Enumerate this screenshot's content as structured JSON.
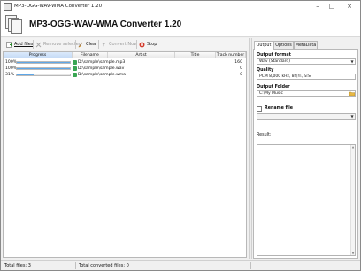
{
  "window": {
    "title": "MP3-OGG-WAV-WMA Converter 1.20",
    "controls": {
      "minimize": "–",
      "maximize": "□",
      "close": "×"
    }
  },
  "header": {
    "app_title": "MP3-OGG-WAV-WMA Converter 1.20"
  },
  "toolbar": {
    "add_files": "Add files",
    "remove_selected": "Remove selected",
    "clear": "Clear",
    "convert_now": "Convert Now",
    "stop": "Stop"
  },
  "file_list": {
    "columns": [
      "Progress",
      "Filename",
      "Artist",
      "Title",
      "Track number"
    ],
    "rows": [
      {
        "progress_label": "100%",
        "progress": 1.0,
        "filename": "D:\\sample\\sample.mp3",
        "artist": "",
        "title": "",
        "track": "160"
      },
      {
        "progress_label": "100%",
        "progress": 1.0,
        "filename": "D:\\sample\\sample.wav",
        "artist": "",
        "title": "",
        "track": "0"
      },
      {
        "progress_label": "31%",
        "progress": 0.31,
        "filename": "D:\\sample\\sample.wma",
        "artist": "",
        "title": "",
        "track": "0"
      }
    ]
  },
  "panel": {
    "tabs": [
      "Output",
      "Options",
      "MetaData"
    ],
    "active_tab": "Output",
    "output_format_label": "Output format",
    "output_format_value": "Wav (Standard)",
    "quality_label": "Quality",
    "quality_value": "PCM 8,000 kHz,  8비트, 모노",
    "output_folder_label": "Output Folder",
    "output_folder_value": "C:\\My Music",
    "rename_label": "Rename file",
    "rename_checked": false,
    "rename_value": "",
    "result_label": "Result:"
  },
  "status": {
    "total_files": "Total files: 3",
    "total_converted": "Total converted files: 0"
  },
  "colors": {
    "progress_fill": "#5ea7e8",
    "progress_header": "#c2d9f5",
    "stop_icon": "#d23a2b",
    "file_icon": "#3aa653"
  }
}
